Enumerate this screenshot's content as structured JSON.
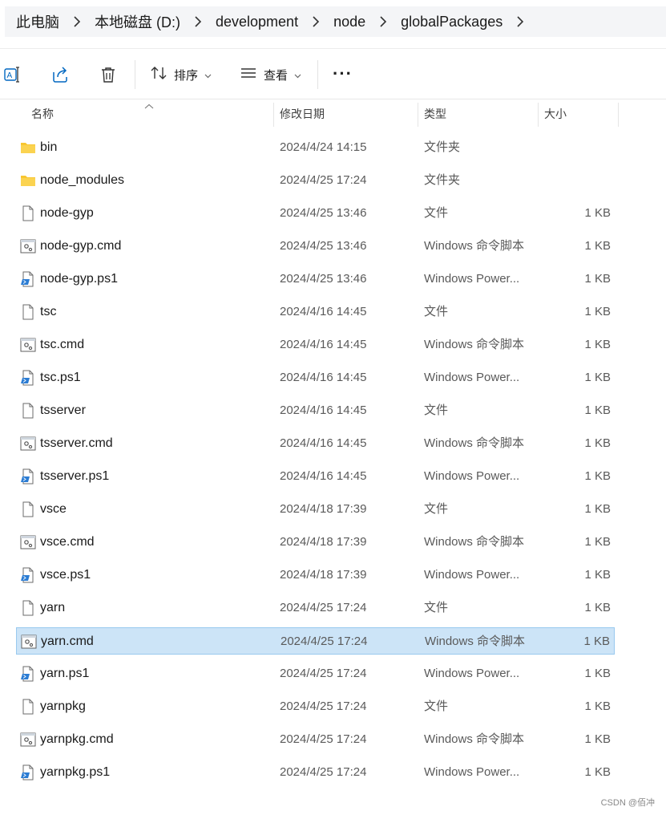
{
  "breadcrumb": [
    "此电脑",
    "本地磁盘 (D:)",
    "development",
    "node",
    "globalPackages"
  ],
  "toolbar": {
    "sort_label": "排序",
    "view_label": "查看"
  },
  "columns": {
    "name": "名称",
    "date": "修改日期",
    "type": "类型",
    "size": "大小"
  },
  "files": [
    {
      "name": "bin",
      "date": "2024/4/24 14:15",
      "type": "文件夹",
      "size": "",
      "icon": "folder-icon"
    },
    {
      "name": "node_modules",
      "date": "2024/4/25 17:24",
      "type": "文件夹",
      "size": "",
      "icon": "folder-icon"
    },
    {
      "name": "node-gyp",
      "date": "2024/4/25 13:46",
      "type": "文件",
      "size": "1 KB",
      "icon": "file-icon"
    },
    {
      "name": "node-gyp.cmd",
      "date": "2024/4/25 13:46",
      "type": "Windows 命令脚本",
      "size": "1 KB",
      "icon": "cmd-file-icon"
    },
    {
      "name": "node-gyp.ps1",
      "date": "2024/4/25 13:46",
      "type": "Windows Power...",
      "size": "1 KB",
      "icon": "powershell-file-icon"
    },
    {
      "name": "tsc",
      "date": "2024/4/16 14:45",
      "type": "文件",
      "size": "1 KB",
      "icon": "file-icon"
    },
    {
      "name": "tsc.cmd",
      "date": "2024/4/16 14:45",
      "type": "Windows 命令脚本",
      "size": "1 KB",
      "icon": "cmd-file-icon"
    },
    {
      "name": "tsc.ps1",
      "date": "2024/4/16 14:45",
      "type": "Windows Power...",
      "size": "1 KB",
      "icon": "powershell-file-icon"
    },
    {
      "name": "tsserver",
      "date": "2024/4/16 14:45",
      "type": "文件",
      "size": "1 KB",
      "icon": "file-icon"
    },
    {
      "name": "tsserver.cmd",
      "date": "2024/4/16 14:45",
      "type": "Windows 命令脚本",
      "size": "1 KB",
      "icon": "cmd-file-icon"
    },
    {
      "name": "tsserver.ps1",
      "date": "2024/4/16 14:45",
      "type": "Windows Power...",
      "size": "1 KB",
      "icon": "powershell-file-icon"
    },
    {
      "name": "vsce",
      "date": "2024/4/18 17:39",
      "type": "文件",
      "size": "1 KB",
      "icon": "file-icon"
    },
    {
      "name": "vsce.cmd",
      "date": "2024/4/18 17:39",
      "type": "Windows 命令脚本",
      "size": "1 KB",
      "icon": "cmd-file-icon"
    },
    {
      "name": "vsce.ps1",
      "date": "2024/4/18 17:39",
      "type": "Windows Power...",
      "size": "1 KB",
      "icon": "powershell-file-icon"
    },
    {
      "name": "yarn",
      "date": "2024/4/25 17:24",
      "type": "文件",
      "size": "1 KB",
      "icon": "file-icon"
    },
    {
      "name": "yarn.cmd",
      "date": "2024/4/25 17:24",
      "type": "Windows 命令脚本",
      "size": "1 KB",
      "icon": "cmd-file-icon",
      "selected": true
    },
    {
      "name": "yarn.ps1",
      "date": "2024/4/25 17:24",
      "type": "Windows Power...",
      "size": "1 KB",
      "icon": "powershell-file-icon"
    },
    {
      "name": "yarnpkg",
      "date": "2024/4/25 17:24",
      "type": "文件",
      "size": "1 KB",
      "icon": "file-icon"
    },
    {
      "name": "yarnpkg.cmd",
      "date": "2024/4/25 17:24",
      "type": "Windows 命令脚本",
      "size": "1 KB",
      "icon": "cmd-file-icon"
    },
    {
      "name": "yarnpkg.ps1",
      "date": "2024/4/25 17:24",
      "type": "Windows Power...",
      "size": "1 KB",
      "icon": "powershell-file-icon"
    }
  ],
  "watermark": "CSDN @佰冲",
  "colors": {
    "selection_bg": "#cce4f7",
    "selection_border": "#99c9ef",
    "folder": "#f8c630",
    "accent": "#0067c0"
  }
}
